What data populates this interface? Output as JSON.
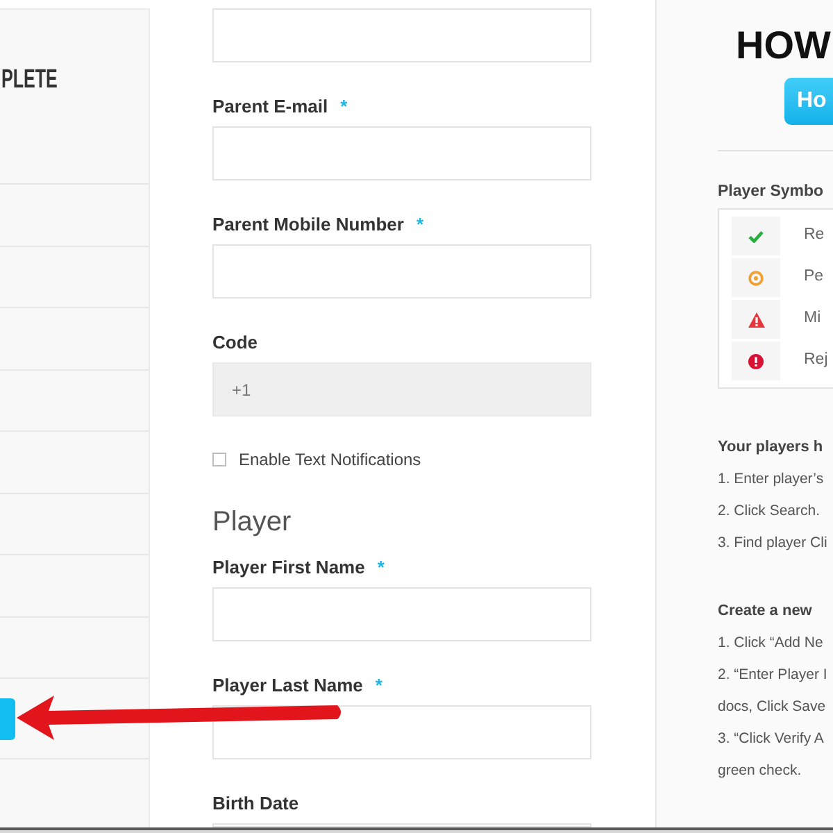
{
  "sidebar": {
    "brand": "PLETE"
  },
  "form": {
    "items": [
      {
        "kind": "field",
        "disabled": false
      },
      {
        "kind": "field",
        "label": "Parent E-mail",
        "required_mark": "*",
        "disabled": false
      },
      {
        "kind": "field",
        "label": "Parent Mobile Number",
        "required_mark": "*",
        "disabled": false
      },
      {
        "kind": "field",
        "label": "Code",
        "value": "+1",
        "disabled": true
      },
      {
        "kind": "checkbox",
        "label": "Enable Text Notifications",
        "checked": false
      },
      {
        "kind": "heading",
        "text": "Player"
      },
      {
        "kind": "field",
        "label": "Player First Name",
        "required_mark": "*",
        "disabled": false
      },
      {
        "kind": "field",
        "label": "Player Last Name",
        "required_mark": "*",
        "disabled": false
      },
      {
        "kind": "field",
        "label": "Birth Date",
        "disabled": false
      }
    ]
  },
  "help": {
    "title": "HOW",
    "button": "Ho",
    "symbols_title": "Player Symbo",
    "symbols": [
      {
        "kind": "check",
        "label": "Re",
        "color": "#27ae3f"
      },
      {
        "kind": "ring",
        "label": "Pe",
        "color": "#f0a030"
      },
      {
        "kind": "warning",
        "label": "Mi",
        "color": "#e8343c"
      },
      {
        "kind": "alert",
        "label": "Rej",
        "color": "#d81135"
      }
    ],
    "sections": [
      {
        "title": "Your players h",
        "steps": [
          "1. Enter player’s",
          "2. Click Search.",
          "3. Find player Cli"
        ]
      },
      {
        "title": "Create a new",
        "steps": [
          "1. Click “Add Ne",
          "2. “Enter Player I",
          "docs, Click Save",
          "3. “Click Verify A",
          "green check."
        ]
      }
    ]
  }
}
